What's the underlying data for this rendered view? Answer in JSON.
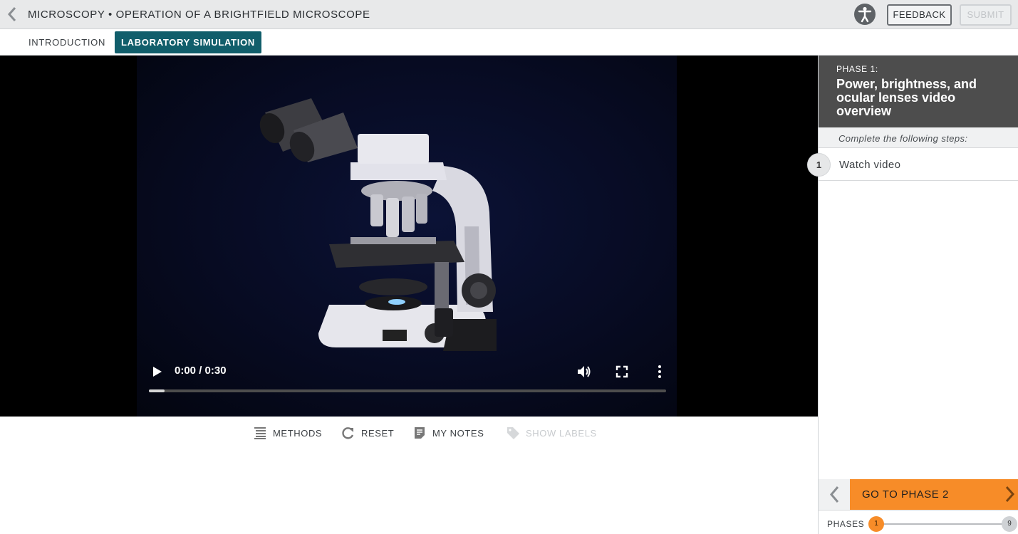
{
  "header": {
    "title": "MICROSCOPY • OPERATION OF A BRIGHTFIELD MICROSCOPE",
    "feedback_label": "FEEDBACK",
    "submit_label": "SUBMIT",
    "icons": {
      "back": "chevron-left-icon",
      "accessibility": "accessibility-icon"
    }
  },
  "tabs": [
    {
      "label": "INTRODUCTION",
      "active": false
    },
    {
      "label": "LABORATORY SIMULATION",
      "active": true
    }
  ],
  "video": {
    "time": "0:00 / 0:30",
    "progress": 0.03,
    "icons": {
      "play": "play-icon",
      "volume": "volume-icon",
      "fullscreen": "fullscreen-icon",
      "more": "more-vertical-icon"
    }
  },
  "toolbar": {
    "methods": "METHODS",
    "reset": "RESET",
    "notes": "MY NOTES",
    "show_labels": "SHOW LABELS"
  },
  "panel": {
    "phase_number": "PHASE 1:",
    "phase_title": "Power, brightness, and ocular lenses video overview",
    "steps_heading": "Complete the following steps:",
    "steps": [
      {
        "number": "1",
        "label": "Watch video"
      }
    ],
    "next_label": "GO TO PHASE 2",
    "phases_label": "PHASES",
    "current_phase": "1",
    "total_phases": "9"
  },
  "colors": {
    "accent_teal": "#115e6b",
    "accent_orange": "#f78c28",
    "panel_header": "#4d4d4d"
  }
}
